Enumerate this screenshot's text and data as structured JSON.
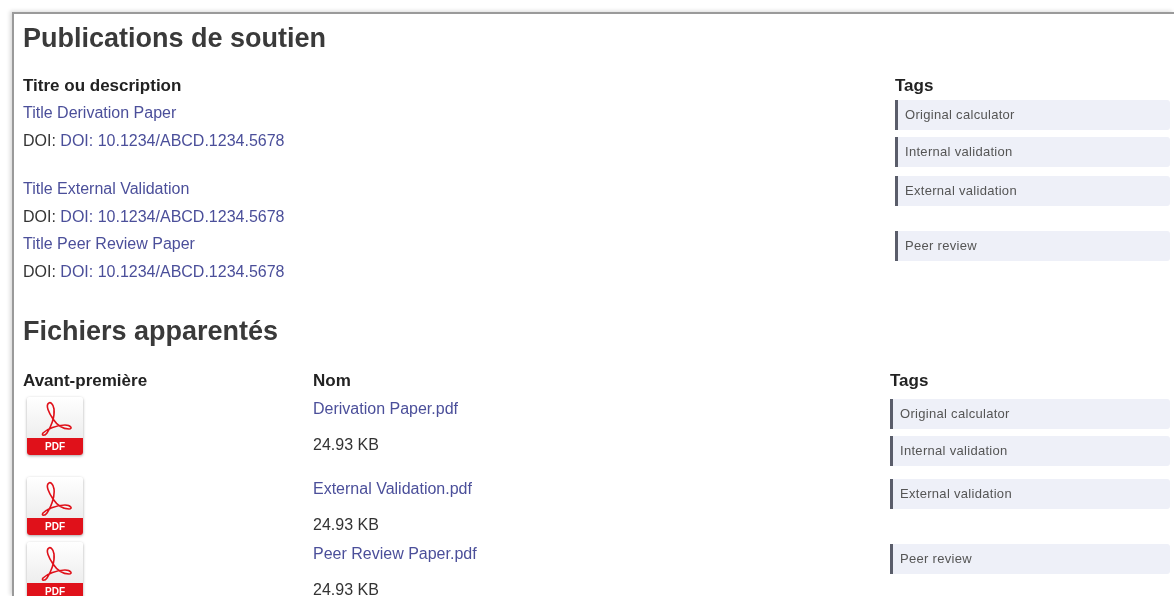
{
  "publications": {
    "heading": "Publications de soutien",
    "columns": [
      "Titre ou description",
      "Tags"
    ],
    "rows": [
      {
        "title": "Title Derivation Paper",
        "doi_label": "DOI:",
        "doi": "DOI: 10.1234/ABCD.1234.5678",
        "tags": [
          "Original calculator",
          "Internal validation"
        ]
      },
      {
        "title": "Title External Validation",
        "doi_label": "DOI:",
        "doi": "DOI: 10.1234/ABCD.1234.5678",
        "tags": [
          "External validation"
        ]
      },
      {
        "title": "Title Peer Review Paper",
        "doi_label": "DOI:",
        "doi": "DOI: 10.1234/ABCD.1234.5678",
        "tags": [
          "Peer review"
        ]
      }
    ]
  },
  "files": {
    "heading": "Fichiers apparentés",
    "columns": [
      "Avant-première",
      "Nom",
      "Tags"
    ],
    "rows": [
      {
        "preview_label": "PDF",
        "name": "Derivation Paper.pdf",
        "size": "24.93 KB",
        "tags": [
          "Original calculator",
          "Internal validation"
        ]
      },
      {
        "preview_label": "PDF",
        "name": "External Validation.pdf",
        "size": "24.93 KB",
        "tags": [
          "External validation"
        ]
      },
      {
        "preview_label": "PDF",
        "name": "Peer Review Paper.pdf",
        "size": "24.93 KB",
        "tags": [
          "Peer review"
        ]
      }
    ]
  }
}
